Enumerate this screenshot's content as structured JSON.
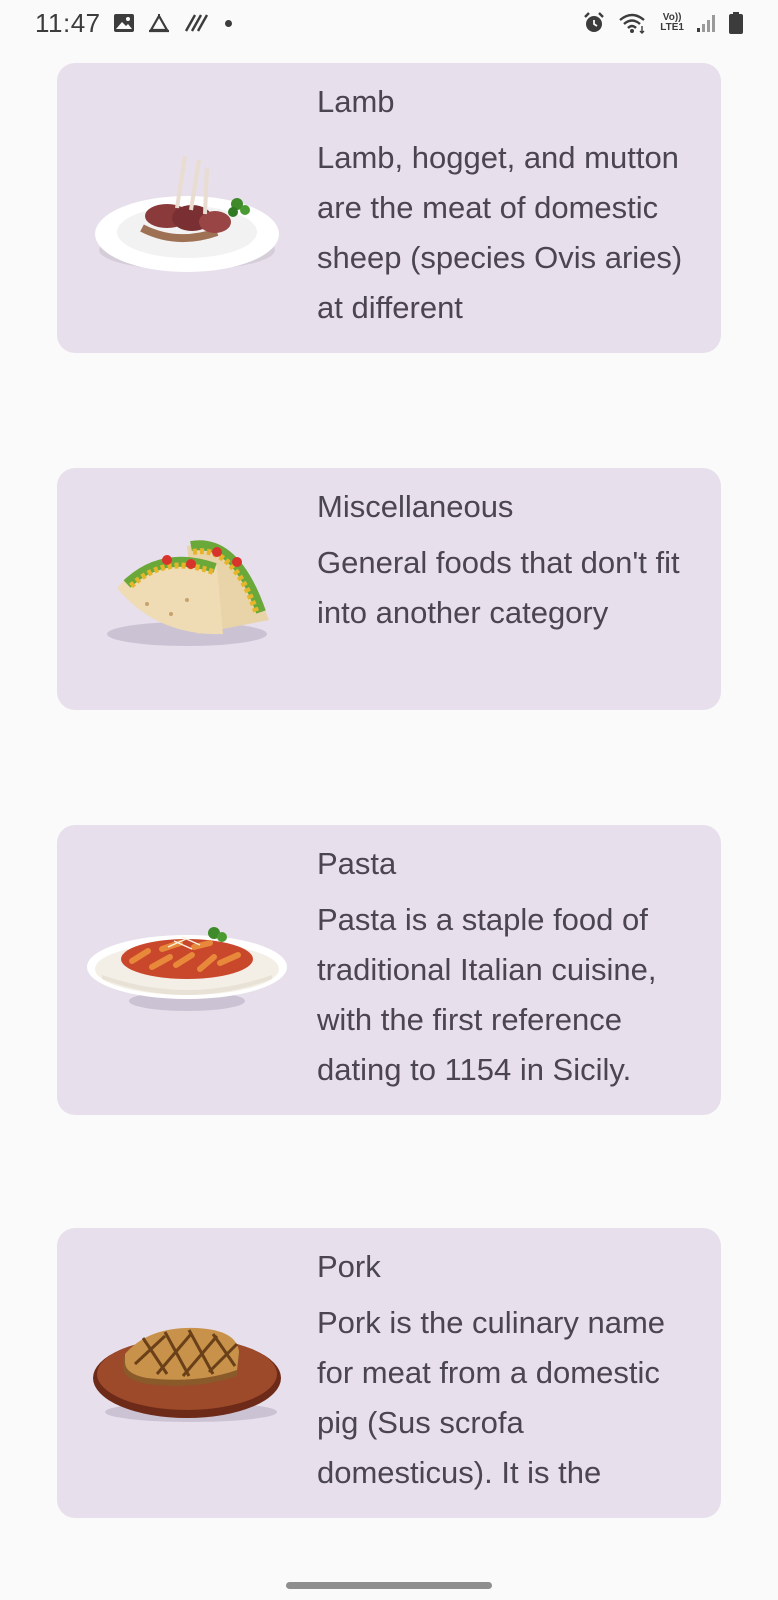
{
  "status_bar": {
    "time": "11:47",
    "lte_top": "Vo))",
    "lte_bottom": "LTE1"
  },
  "categories": [
    {
      "title": "Lamb",
      "description": "Lamb, hogget, and mutton are the meat of domestic sheep (species Ovis aries) at different",
      "image_icon": "lamb-chops-plate"
    },
    {
      "title": "Miscellaneous",
      "description": "General foods that don't fit into another category",
      "image_icon": "tacos"
    },
    {
      "title": "Pasta",
      "description": "Pasta is a staple food of traditional Italian cuisine, with the first reference dating to 1154 in Sicily.",
      "image_icon": "pasta-plate"
    },
    {
      "title": "Pork",
      "description": "Pork is the culinary name for meat from a domestic pig (Sus scrofa domesticus). It is the",
      "image_icon": "pork-chop-board"
    }
  ],
  "colors": {
    "card_background": "#e7dfeb",
    "page_background": "#fbfafb",
    "text": "#4a4550"
  }
}
